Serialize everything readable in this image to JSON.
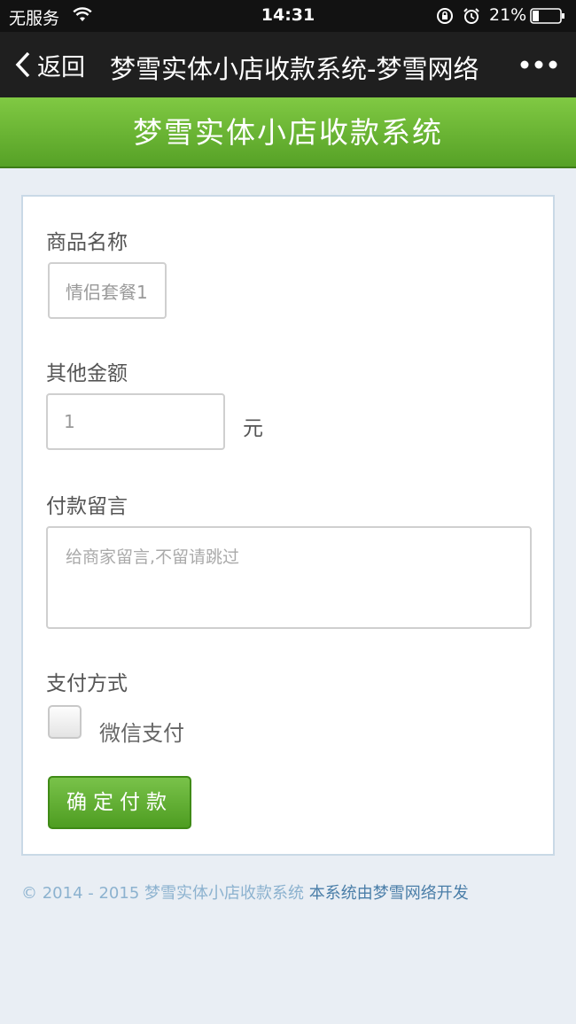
{
  "status_bar": {
    "carrier": "无服务",
    "time": "14:31",
    "battery": "21%"
  },
  "nav": {
    "back_label": "返回",
    "title": "梦雪实体小店收款系统-梦雪网络"
  },
  "header": {
    "title": "梦雪实体小店收款系统"
  },
  "form": {
    "product_label": "商品名称",
    "product_value": "情侣套餐1",
    "amount_label": "其他金额",
    "amount_value": "1",
    "amount_unit": "元",
    "message_label": "付款留言",
    "message_placeholder": "给商家留言,不留请跳过",
    "payment_label": "支付方式",
    "payment_option": "微信支付",
    "submit_label": "确定付款"
  },
  "footer": {
    "copyright": "© 2014 - 2015 梦雪实体小店收款系统 ",
    "link": "本系统由梦雪网络开发"
  }
}
